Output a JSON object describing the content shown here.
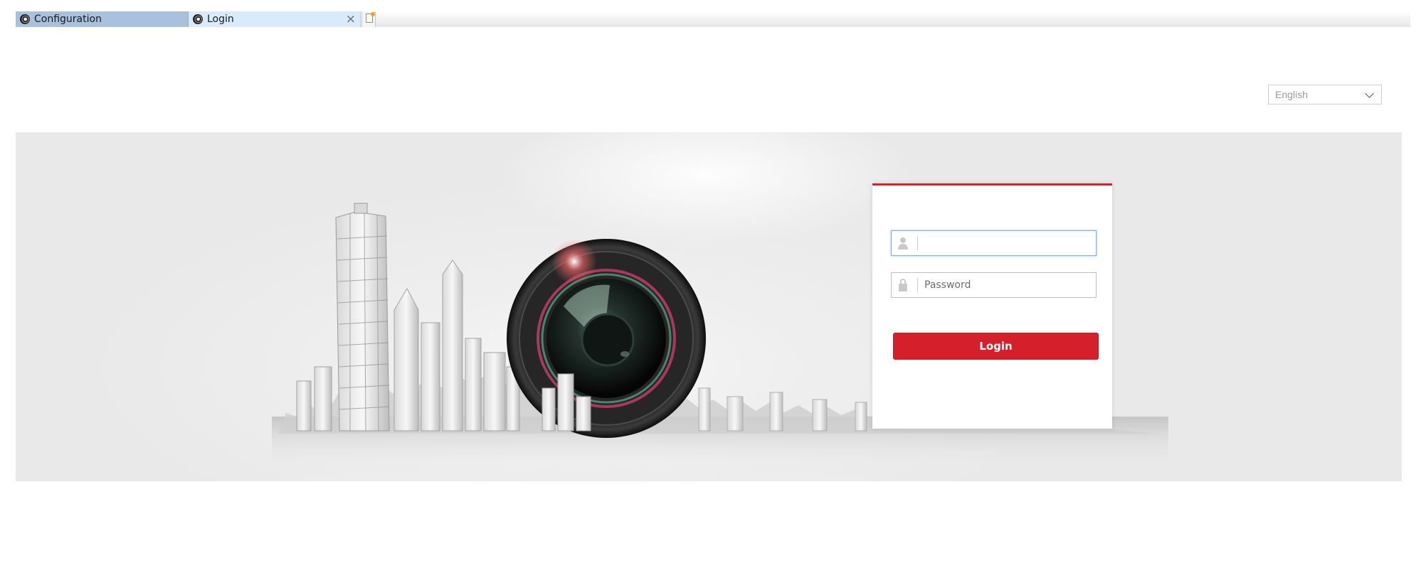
{
  "tabs": [
    {
      "label": "Configuration",
      "icon": "camera-icon",
      "active": false
    },
    {
      "label": "Login",
      "icon": "camera-icon",
      "active": true,
      "close_icon": "close-icon"
    }
  ],
  "new_tab": {
    "icon": "new-tab-icon"
  },
  "language": {
    "selected": "English",
    "icon": "chevron-down-icon"
  },
  "login": {
    "username": {
      "value": "",
      "placeholder": "",
      "icon": "user-icon"
    },
    "password": {
      "value": "",
      "placeholder": "Password",
      "icon": "lock-icon"
    },
    "button_label": "Login"
  },
  "colors": {
    "accent": "#d6232c",
    "active_tab": "#d9eafb",
    "inactive_tab": "#a9c1dc",
    "focus_border": "#7fb0e2"
  }
}
